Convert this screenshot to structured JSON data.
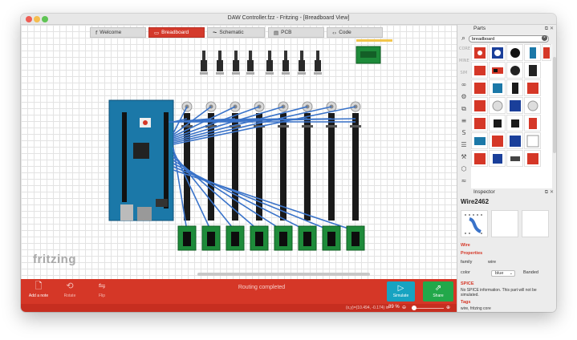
{
  "window": {
    "title": "DAW Controller.fzz - Fritzing - [Breadboard View]"
  },
  "tabs": [
    {
      "label": "Welcome",
      "icon": "f"
    },
    {
      "label": "Breadboard",
      "icon": "▭"
    },
    {
      "label": "Schematic",
      "icon": "⏦"
    },
    {
      "label": "PCB",
      "icon": "▤"
    },
    {
      "label": "Code",
      "icon": "‹›"
    }
  ],
  "canvas": {
    "logo_text": "fritzing"
  },
  "toolbar": {
    "add_note": "Add a note",
    "rotate": "Rotate",
    "flip": "Flip",
    "routing_status": "Routing completed",
    "simulate": "Simulate",
    "share": "Share"
  },
  "statusbar": {
    "coords": "(x,y)=(10.494, -0.174) in",
    "zoom": "89 %"
  },
  "parts": {
    "header": "Parts",
    "search_value": "breadboard",
    "bins": [
      "CORE",
      "MINE",
      "SIM",
      "∞",
      "⚙",
      "⧉",
      "≡",
      "S",
      "☰",
      "⚒",
      "⬡",
      "≈"
    ]
  },
  "inspector": {
    "header": "Inspector",
    "title": "Wire2462",
    "section_wire": "Wire",
    "section_properties": "Properties",
    "family_label": "family",
    "family_value": "wire",
    "color_label": "color",
    "color_value": "blue",
    "banded_label": "Banded",
    "section_spice": "SPICE",
    "spice_note": "No SPICE information. This part will not be simulated.",
    "section_tags": "Tags",
    "tags_value": "wire, fritzing core"
  },
  "colors": {
    "accent_red": "#d53727",
    "wire_blue": "#3a73c9",
    "arduino_teal": "#1b78a8",
    "pcb_green": "#1e8b3a",
    "simulate_blue": "#17a3c1",
    "share_green": "#22a84a"
  }
}
